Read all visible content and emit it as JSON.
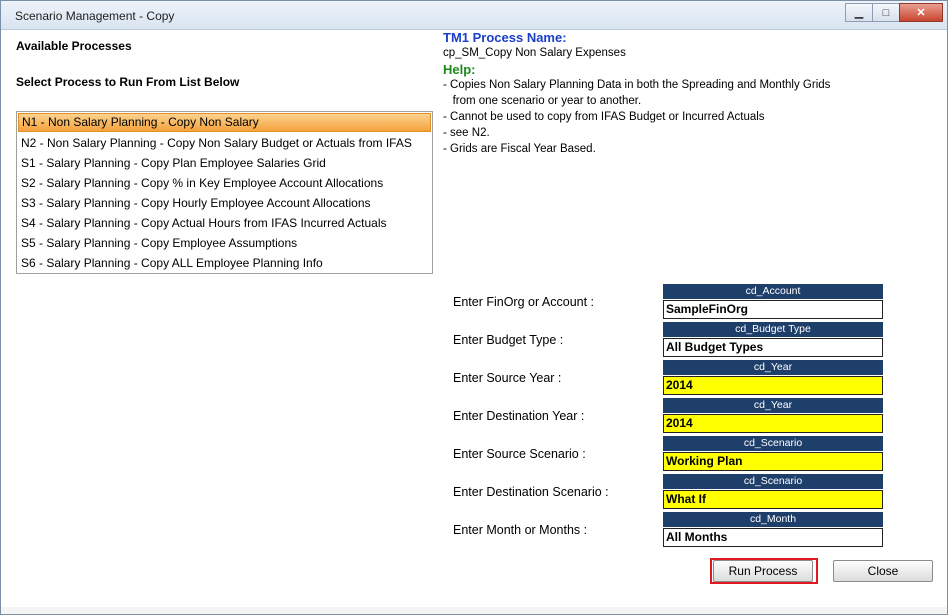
{
  "window": {
    "title": "Scenario Management - Copy"
  },
  "left": {
    "available_label": "Available Processes",
    "select_label": "Select Process to Run From List Below",
    "processes": [
      "N1 - Non Salary Planning - Copy Non Salary",
      "N2 - Non Salary Planning - Copy Non Salary Budget or Actuals from IFAS",
      "S1 - Salary Planning - Copy Plan Employee Salaries Grid",
      "S2 - Salary Planning - Copy % in Key Employee Account Allocations",
      "S3 - Salary Planning - Copy Hourly Employee Account Allocations",
      "S4 - Salary Planning - Copy Actual Hours from IFAS Incurred Actuals",
      "S5 - Salary Planning - Copy Employee Assumptions",
      "S6 - Salary Planning - Copy ALL Employee Planning Info"
    ],
    "selected_index": 0
  },
  "info": {
    "process_name_label": "TM1 Process Name:",
    "process_name": "cp_SM_Copy Non Salary Expenses",
    "help_label": "Help:",
    "help_lines": [
      "- Copies Non Salary Planning Data in both the Spreading and Monthly Grids",
      "   from one scenario or year to another.",
      "- Cannot be used to copy from IFAS Budget or Incurred Actuals",
      "- see N2.",
      "- Grids are Fiscal Year Based."
    ]
  },
  "fields": [
    {
      "label": "Enter FinOrg or Account :",
      "dimension": "cd_Account",
      "value": "SampleFinOrg",
      "highlight": false
    },
    {
      "label": "Enter Budget Type :",
      "dimension": "cd_Budget Type",
      "value": "All Budget Types",
      "highlight": false
    },
    {
      "label": "Enter Source Year :",
      "dimension": "cd_Year",
      "value": "2014",
      "highlight": true
    },
    {
      "label": "Enter Destination Year :",
      "dimension": "cd_Year",
      "value": "2014",
      "highlight": true
    },
    {
      "label": "Enter Source Scenario :",
      "dimension": "cd_Scenario",
      "value": "Working Plan",
      "highlight": true
    },
    {
      "label": "Enter Destination Scenario :",
      "dimension": "cd_Scenario",
      "value": "What If",
      "highlight": true
    },
    {
      "label": "Enter Month or Months :",
      "dimension": "cd_Month",
      "value": "All Months",
      "highlight": false
    }
  ],
  "buttons": {
    "run": "Run Process",
    "close": "Close"
  },
  "colors": {
    "dim_header": "#1f3f6b",
    "highlight": "#ffff00",
    "selection": "#f5a23c",
    "run_outline": "#e0191f"
  }
}
